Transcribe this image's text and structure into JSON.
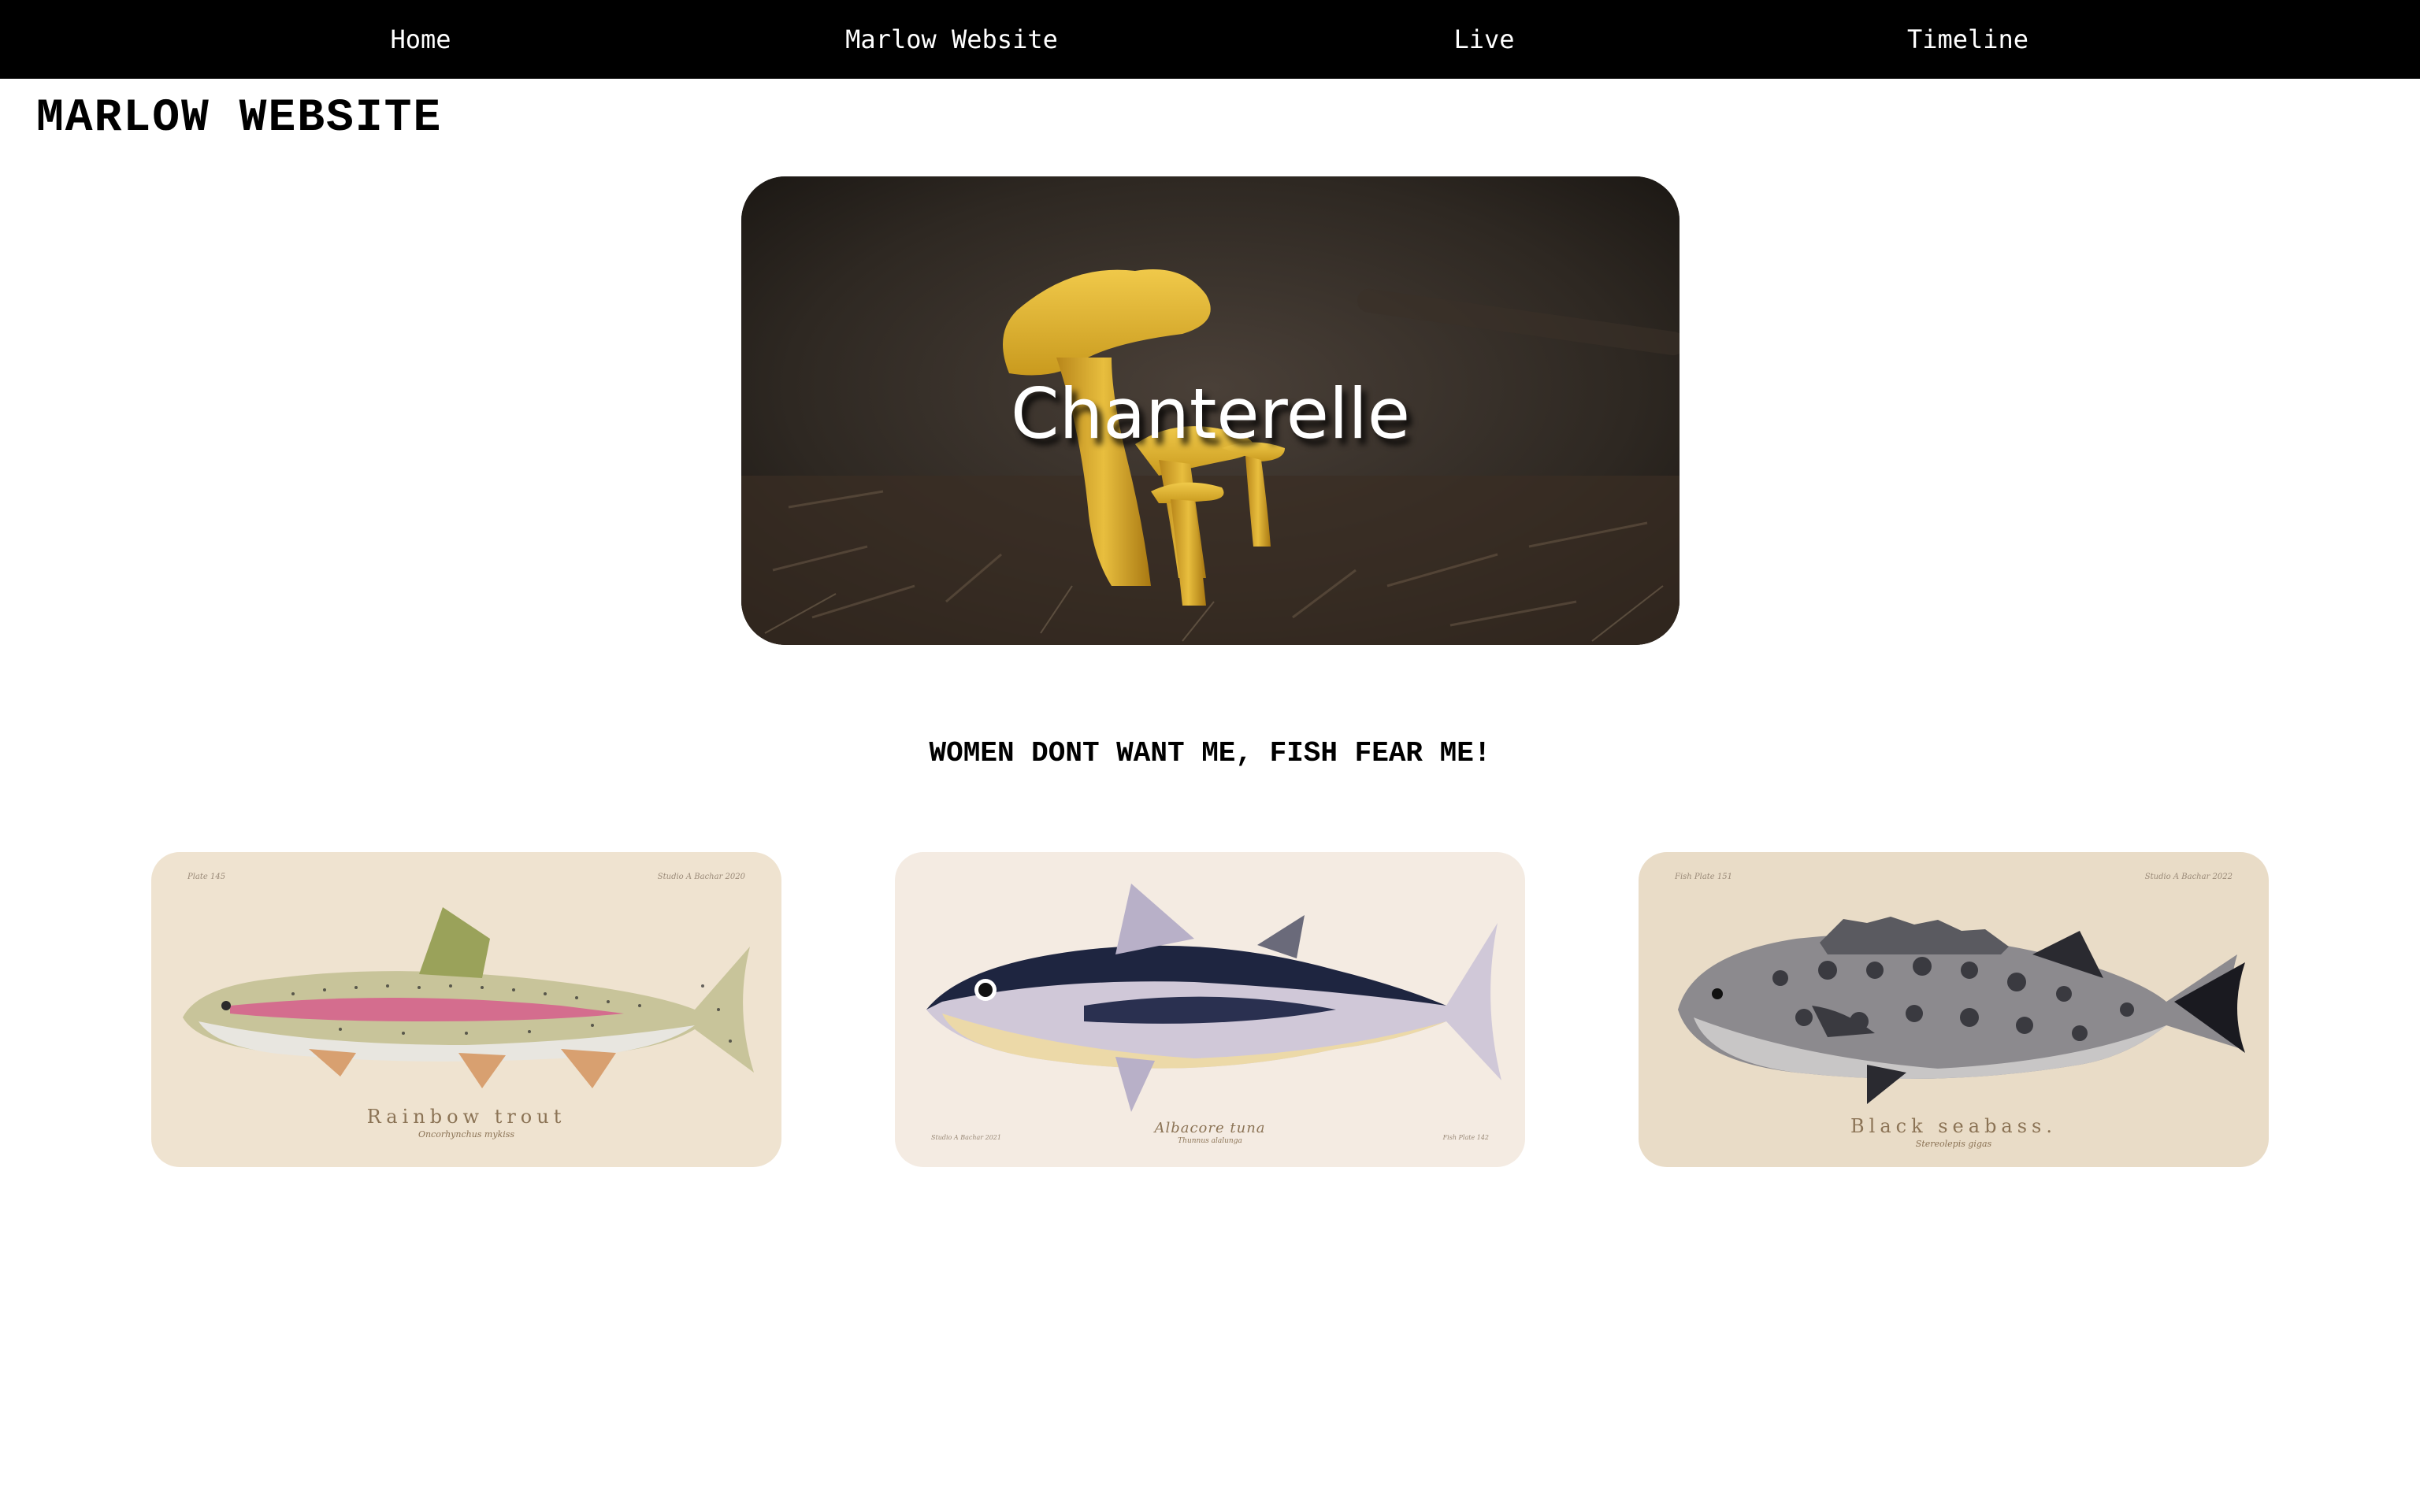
{
  "nav": {
    "items": [
      {
        "label": "Home"
      },
      {
        "label": "Marlow Website"
      },
      {
        "label": "Live"
      },
      {
        "label": "Timeline"
      }
    ]
  },
  "header": {
    "title": "MARLOW WEBSITE"
  },
  "hero": {
    "label": "Chanterelle",
    "image": "chanterelle-mushroom-photo"
  },
  "tagline": "WOMEN DONT WANT ME, FISH FEAR ME!",
  "cards": [
    {
      "image": "rainbow-trout-illustration",
      "name": "Rainbow trout",
      "latin": "Oncorhynchus mykiss",
      "plate_left": "Plate 145",
      "plate_right": "Studio A Bachar 2020"
    },
    {
      "image": "albacore-tuna-illustration",
      "name": "Albacore tuna",
      "latin": "Thunnus alalunga",
      "plate_left": "Studio A Bachar 2021",
      "plate_right": "Fish Plate 142"
    },
    {
      "image": "black-seabass-illustration",
      "name": "Black seabass.",
      "latin": "Stereolepis gigas",
      "plate_left": "Fish Plate 151",
      "plate_right": "Studio A Bachar 2022"
    }
  ],
  "colors": {
    "nav_background": "#000000",
    "nav_text": "#ffffff",
    "page_background": "#ffffff",
    "caption": "#8b7355"
  }
}
